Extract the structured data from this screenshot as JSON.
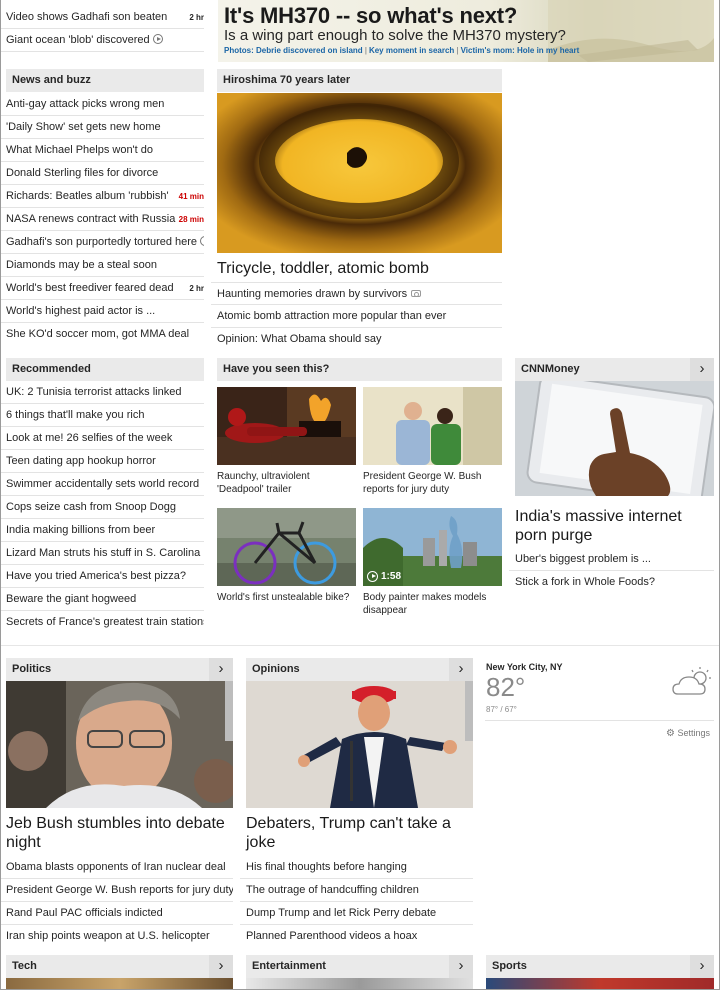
{
  "top_stories": [
    {
      "text": "Video shows Gadhafi son beaten",
      "tag": "2 hr",
      "tag_color": "dark"
    },
    {
      "text": "Giant ocean 'blob' discovered",
      "icon": "play-icon"
    }
  ],
  "mh370": {
    "headline": "It's MH370 -- so what's next?",
    "subhead": "Is a wing part enough to solve the MH370 mystery?",
    "links": [
      "Photos: Debrie discovered on island",
      "Key moment in search",
      "Victim's mom: Hole in my heart"
    ]
  },
  "news_and_buzz": {
    "header": "News and buzz",
    "items": [
      {
        "text": "Anti-gay attack picks wrong men"
      },
      {
        "text": "'Daily Show' set gets new home"
      },
      {
        "text": "What Michael Phelps won't do"
      },
      {
        "text": "Donald Sterling files for divorce"
      },
      {
        "text": "Richards: Beatles album 'rubbish'",
        "tag": "41 min",
        "tag_color": "red"
      },
      {
        "text": "NASA renews contract with Russia",
        "tag": "28 min",
        "tag_color": "red"
      },
      {
        "text": "Gadhafi's son purportedly tortured here",
        "icon": "play-icon"
      },
      {
        "text": "Diamonds may be a steal soon"
      },
      {
        "text": "World's best freediver feared dead",
        "tag": "2 hr",
        "tag_color": "dark"
      },
      {
        "text": "World's highest paid actor is ..."
      },
      {
        "text": "She KO'd soccer mom, got MMA deal"
      }
    ]
  },
  "hiroshima": {
    "header": "Hiroshima 70 years later",
    "headline": "Tricycle, toddler, atomic bomb",
    "items": [
      {
        "text": "Haunting memories drawn by survivors",
        "icon": "camera-icon"
      },
      {
        "text": "Atomic bomb attraction more popular than ever"
      },
      {
        "text": "Opinion: What Obama should say"
      }
    ]
  },
  "recommended": {
    "header": "Recommended",
    "items": [
      "UK: 2 Tunisia terrorist attacks linked",
      "6 things that'll make you rich",
      "Look at me! 26 selfies of the week",
      "Teen dating app hookup horror",
      "Swimmer accidentally sets world record",
      "Cops seize cash from Snoop Dogg",
      "India making billions from beer",
      "Lizard Man struts his stuff in S. Carolina",
      "Have you tried America's best pizza?",
      "Beware the giant hogweed",
      "Secrets of France's greatest train stations"
    ]
  },
  "have_you_seen": {
    "header": "Have you seen this?",
    "cards": [
      {
        "caption": "Raunchy, ultraviolent 'Deadpool' trailer"
      },
      {
        "caption": "President George W. Bush reports for jury duty"
      },
      {
        "caption": "World's first unstealable bike?"
      },
      {
        "caption": "Body painter makes models disappear",
        "duration": "1:58"
      }
    ]
  },
  "cnnmoney": {
    "header": "CNNMoney",
    "arrow": "›",
    "headline": "India's massive internet porn purge",
    "items": [
      "Uber's biggest problem is ...",
      "Stick a fork in Whole Foods?"
    ]
  },
  "politics": {
    "header": "Politics",
    "arrow": "›",
    "headline": "Jeb Bush stumbles into debate night",
    "items": [
      "Obama blasts opponents of Iran nuclear deal",
      "President George W. Bush reports for jury duty",
      "Rand Paul PAC officials indicted",
      "Iran ship points weapon at U.S. helicopter"
    ]
  },
  "opinions": {
    "header": "Opinions",
    "arrow": "›",
    "headline": "Debaters, Trump can't take a joke",
    "items": [
      "His final thoughts before hanging",
      "The outrage of handcuffing children",
      "Dump Trump and let Rick Perry debate",
      "Planned Parenthood videos a hoax"
    ]
  },
  "weather": {
    "city": "New York City, NY",
    "temp": "82°",
    "range": "87° / 67°",
    "settings_label": "Settings",
    "condition_icon": "partly-cloudy-icon"
  },
  "bottom_sections": [
    {
      "header": "Tech",
      "arrow": "›"
    },
    {
      "header": "Entertainment",
      "arrow": "›"
    },
    {
      "header": "Sports",
      "arrow": "›"
    }
  ],
  "colors": {
    "link_blue": "#1a65a6",
    "badge_red": "#cc0000",
    "header_gray": "#eaeaea"
  }
}
